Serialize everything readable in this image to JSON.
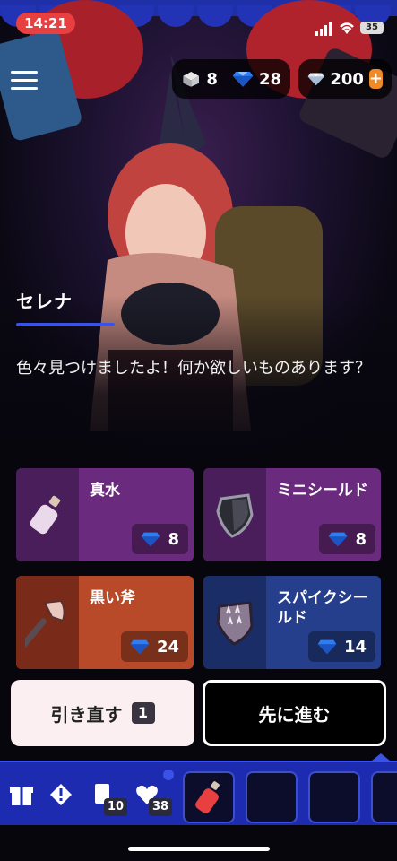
{
  "status_bar": {
    "time": "14:21",
    "battery": "35"
  },
  "currency": {
    "chests": "8",
    "gems": "28",
    "diamonds": "200",
    "plus_label": "+"
  },
  "character": {
    "name": "セレナ",
    "dialogue": "色々見つけましたよ！何か欲しいものあります？"
  },
  "shop": {
    "items": [
      {
        "name": "真水",
        "price": "8",
        "icon": "water-bottle-icon"
      },
      {
        "name": "ミニシールド",
        "price": "8",
        "icon": "small-shield-icon"
      },
      {
        "name": "黒い斧",
        "price": "24",
        "icon": "black-axe-icon"
      },
      {
        "name": "スパイクシールド",
        "price": "14",
        "icon": "spike-shield-icon"
      }
    ]
  },
  "actions": {
    "reroll_label": "引き直す",
    "reroll_count": "1",
    "next_label": "先に進む"
  },
  "bottom_bar": {
    "cards_count": "10",
    "health": "38"
  },
  "colors": {
    "accent_blue": "#1d2bb0",
    "card_purple": "#6a2a7d",
    "card_orange": "#b84a2a",
    "card_navy": "#253f8c",
    "time_red": "#e84040",
    "plus_orange": "#f08a24"
  }
}
